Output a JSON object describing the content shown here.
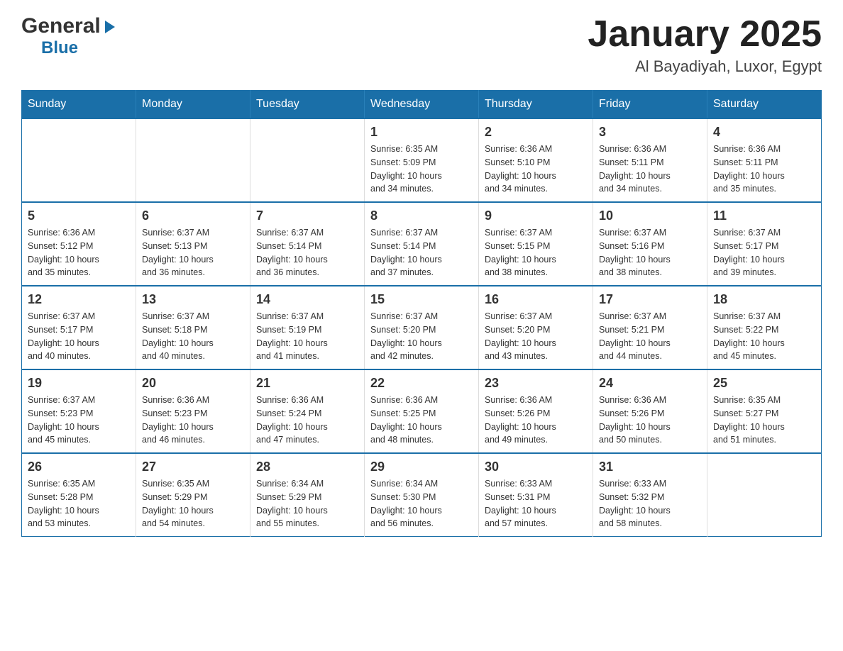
{
  "header": {
    "logo_general": "General",
    "logo_arrow": "▶",
    "logo_blue": "Blue",
    "title": "January 2025",
    "subtitle": "Al Bayadiyah, Luxor, Egypt"
  },
  "days_of_week": [
    "Sunday",
    "Monday",
    "Tuesday",
    "Wednesday",
    "Thursday",
    "Friday",
    "Saturday"
  ],
  "weeks": [
    [
      {
        "day": "",
        "info": ""
      },
      {
        "day": "",
        "info": ""
      },
      {
        "day": "",
        "info": ""
      },
      {
        "day": "1",
        "info": "Sunrise: 6:35 AM\nSunset: 5:09 PM\nDaylight: 10 hours\nand 34 minutes."
      },
      {
        "day": "2",
        "info": "Sunrise: 6:36 AM\nSunset: 5:10 PM\nDaylight: 10 hours\nand 34 minutes."
      },
      {
        "day": "3",
        "info": "Sunrise: 6:36 AM\nSunset: 5:11 PM\nDaylight: 10 hours\nand 34 minutes."
      },
      {
        "day": "4",
        "info": "Sunrise: 6:36 AM\nSunset: 5:11 PM\nDaylight: 10 hours\nand 35 minutes."
      }
    ],
    [
      {
        "day": "5",
        "info": "Sunrise: 6:36 AM\nSunset: 5:12 PM\nDaylight: 10 hours\nand 35 minutes."
      },
      {
        "day": "6",
        "info": "Sunrise: 6:37 AM\nSunset: 5:13 PM\nDaylight: 10 hours\nand 36 minutes."
      },
      {
        "day": "7",
        "info": "Sunrise: 6:37 AM\nSunset: 5:14 PM\nDaylight: 10 hours\nand 36 minutes."
      },
      {
        "day": "8",
        "info": "Sunrise: 6:37 AM\nSunset: 5:14 PM\nDaylight: 10 hours\nand 37 minutes."
      },
      {
        "day": "9",
        "info": "Sunrise: 6:37 AM\nSunset: 5:15 PM\nDaylight: 10 hours\nand 38 minutes."
      },
      {
        "day": "10",
        "info": "Sunrise: 6:37 AM\nSunset: 5:16 PM\nDaylight: 10 hours\nand 38 minutes."
      },
      {
        "day": "11",
        "info": "Sunrise: 6:37 AM\nSunset: 5:17 PM\nDaylight: 10 hours\nand 39 minutes."
      }
    ],
    [
      {
        "day": "12",
        "info": "Sunrise: 6:37 AM\nSunset: 5:17 PM\nDaylight: 10 hours\nand 40 minutes."
      },
      {
        "day": "13",
        "info": "Sunrise: 6:37 AM\nSunset: 5:18 PM\nDaylight: 10 hours\nand 40 minutes."
      },
      {
        "day": "14",
        "info": "Sunrise: 6:37 AM\nSunset: 5:19 PM\nDaylight: 10 hours\nand 41 minutes."
      },
      {
        "day": "15",
        "info": "Sunrise: 6:37 AM\nSunset: 5:20 PM\nDaylight: 10 hours\nand 42 minutes."
      },
      {
        "day": "16",
        "info": "Sunrise: 6:37 AM\nSunset: 5:20 PM\nDaylight: 10 hours\nand 43 minutes."
      },
      {
        "day": "17",
        "info": "Sunrise: 6:37 AM\nSunset: 5:21 PM\nDaylight: 10 hours\nand 44 minutes."
      },
      {
        "day": "18",
        "info": "Sunrise: 6:37 AM\nSunset: 5:22 PM\nDaylight: 10 hours\nand 45 minutes."
      }
    ],
    [
      {
        "day": "19",
        "info": "Sunrise: 6:37 AM\nSunset: 5:23 PM\nDaylight: 10 hours\nand 45 minutes."
      },
      {
        "day": "20",
        "info": "Sunrise: 6:36 AM\nSunset: 5:23 PM\nDaylight: 10 hours\nand 46 minutes."
      },
      {
        "day": "21",
        "info": "Sunrise: 6:36 AM\nSunset: 5:24 PM\nDaylight: 10 hours\nand 47 minutes."
      },
      {
        "day": "22",
        "info": "Sunrise: 6:36 AM\nSunset: 5:25 PM\nDaylight: 10 hours\nand 48 minutes."
      },
      {
        "day": "23",
        "info": "Sunrise: 6:36 AM\nSunset: 5:26 PM\nDaylight: 10 hours\nand 49 minutes."
      },
      {
        "day": "24",
        "info": "Sunrise: 6:36 AM\nSunset: 5:26 PM\nDaylight: 10 hours\nand 50 minutes."
      },
      {
        "day": "25",
        "info": "Sunrise: 6:35 AM\nSunset: 5:27 PM\nDaylight: 10 hours\nand 51 minutes."
      }
    ],
    [
      {
        "day": "26",
        "info": "Sunrise: 6:35 AM\nSunset: 5:28 PM\nDaylight: 10 hours\nand 53 minutes."
      },
      {
        "day": "27",
        "info": "Sunrise: 6:35 AM\nSunset: 5:29 PM\nDaylight: 10 hours\nand 54 minutes."
      },
      {
        "day": "28",
        "info": "Sunrise: 6:34 AM\nSunset: 5:29 PM\nDaylight: 10 hours\nand 55 minutes."
      },
      {
        "day": "29",
        "info": "Sunrise: 6:34 AM\nSunset: 5:30 PM\nDaylight: 10 hours\nand 56 minutes."
      },
      {
        "day": "30",
        "info": "Sunrise: 6:33 AM\nSunset: 5:31 PM\nDaylight: 10 hours\nand 57 minutes."
      },
      {
        "day": "31",
        "info": "Sunrise: 6:33 AM\nSunset: 5:32 PM\nDaylight: 10 hours\nand 58 minutes."
      },
      {
        "day": "",
        "info": ""
      }
    ]
  ]
}
